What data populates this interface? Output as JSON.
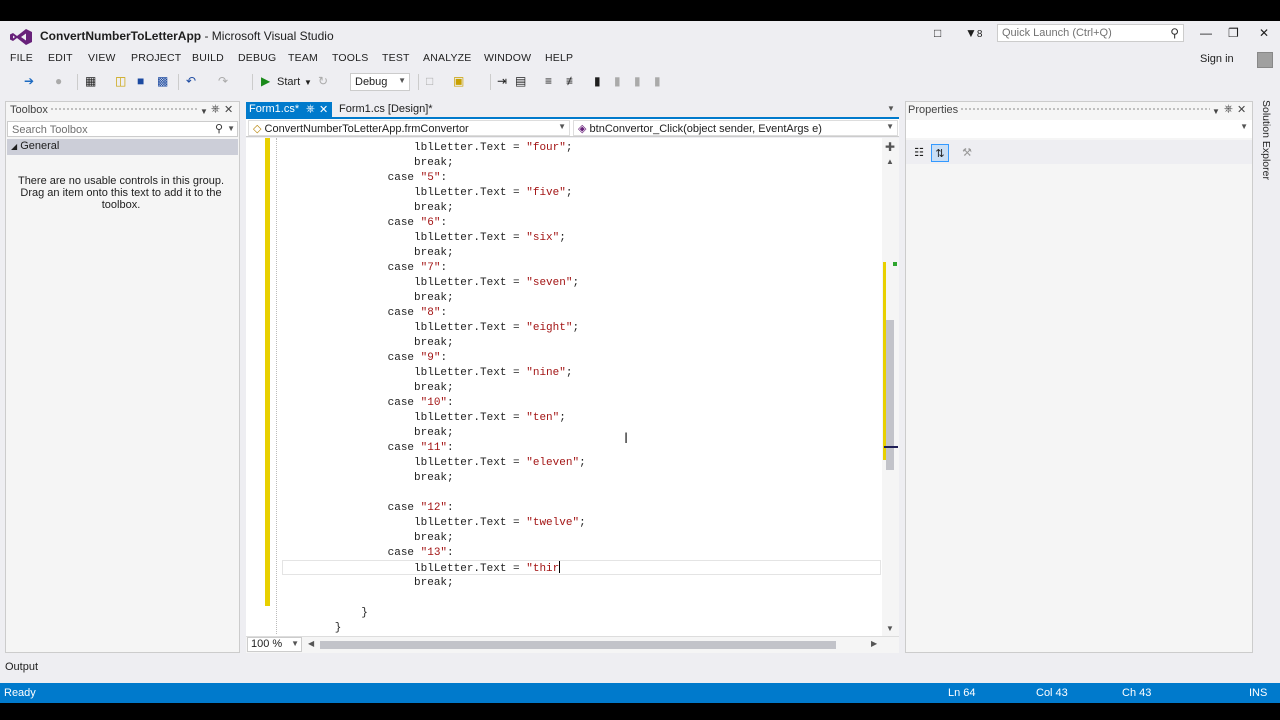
{
  "window": {
    "title_app": "ConvertNumberToLetterApp",
    "title_suffix": " - Microsoft Visual Studio",
    "notification_count": "8",
    "quick_launch_placeholder": "Quick Launch (Ctrl+Q)"
  },
  "menu": [
    "FILE",
    "EDIT",
    "VIEW",
    "PROJECT",
    "BUILD",
    "DEBUG",
    "TEAM",
    "TOOLS",
    "TEST",
    "ANALYZE",
    "WINDOW",
    "HELP"
  ],
  "account": {
    "sign_in": "Sign in"
  },
  "toolbar": {
    "start_label": "Start",
    "config_value": "Debug"
  },
  "toolbox": {
    "title": "Toolbox",
    "search_placeholder": "Search Toolbox",
    "group": "General",
    "empty_message": "There are no usable controls in this group. Drag an item onto this text to add it to the toolbox."
  },
  "tabs": [
    {
      "label": "Form1.cs*",
      "active": true
    },
    {
      "label": "Form1.cs [Design]*",
      "active": false
    }
  ],
  "navigation": {
    "class_scope": "ConvertNumberToLetterApp.frmConvertor",
    "member_scope": "btnConvertor_Click(object sender, EventArgs e)"
  },
  "editor": {
    "lines": [
      "                    lblLetter.Text = \"four\";",
      "                    break;",
      "                case \"5\":",
      "                    lblLetter.Text = \"five\";",
      "                    break;",
      "                case \"6\":",
      "                    lblLetter.Text = \"six\";",
      "                    break;",
      "                case \"7\":",
      "                    lblLetter.Text = \"seven\";",
      "                    break;",
      "                case \"8\":",
      "                    lblLetter.Text = \"eight\";",
      "                    break;",
      "                case \"9\":",
      "                    lblLetter.Text = \"nine\";",
      "                    break;",
      "                case \"10\":",
      "                    lblLetter.Text = \"ten\";",
      "                    break;",
      "                case \"11\":",
      "                    lblLetter.Text = \"eleven\";",
      "                    break;",
      "",
      "                case \"12\":",
      "                    lblLetter.Text = \"twelve\";",
      "                    break;",
      "                case \"13\":",
      "                    lblLetter.Text = \"thir",
      "                    break;",
      "            }",
      "        }"
    ],
    "zoom": "100 %"
  },
  "properties": {
    "title": "Properties"
  },
  "solution_explorer": {
    "tab_label": "Solution Explorer"
  },
  "output": {
    "label": "Output"
  },
  "status": {
    "state": "Ready",
    "line": "Ln 64",
    "col": "Col 43",
    "ch": "Ch 43",
    "mode": "INS"
  },
  "colors": {
    "accent": "#007acc",
    "string": "#a31515",
    "change_marker": "#e8d000"
  }
}
